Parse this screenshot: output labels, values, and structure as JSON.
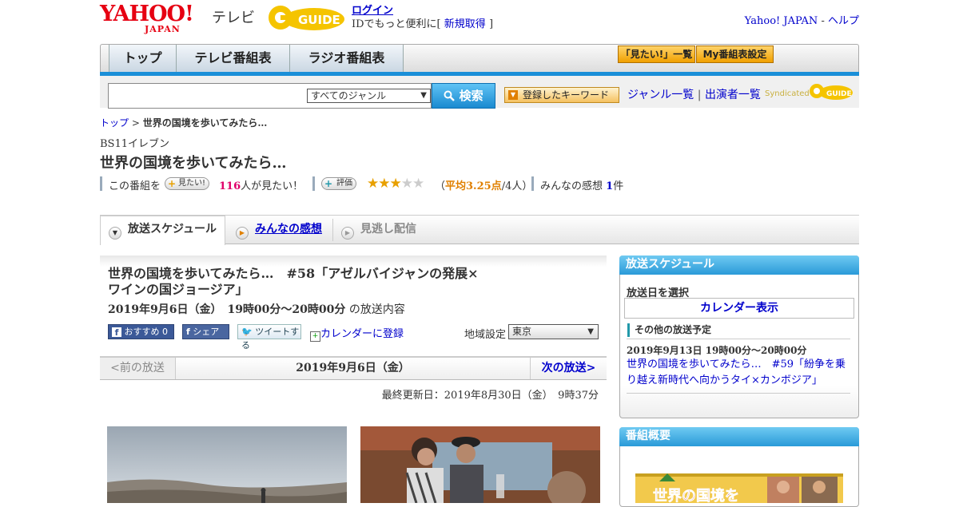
{
  "header": {
    "yahoo_logo_text": "YAHOO!",
    "yahoo_logo_sub": "JAPAN",
    "tv_label": "テレビ",
    "gguide_logo_text": "GUIDE",
    "login": "ログイン",
    "login_note_pre": "IDでもっと便利に[",
    "signup": "新規取得",
    "login_note_post": "]",
    "yahoo_japan_link": "Yahoo! JAPAN",
    "separator": "-",
    "help_link": "ヘルプ"
  },
  "nav": {
    "tabs": [
      "トップ",
      "テレビ番組表",
      "ラジオ番組表"
    ],
    "mitai_list": "「見たい!」一覧",
    "my_schedule": "My番組表設定"
  },
  "search": {
    "placeholder": "",
    "genre_selected": "すべてのジャンル",
    "search_button": "検索",
    "keyword_button": "登録したキーワード",
    "genre_list": "ジャンル一覧",
    "link_separator": "|",
    "performer_list": "出演者一覧",
    "syndicated": "Syndicated",
    "syndicated_logo_text": "GUIDE"
  },
  "breadcrumb": {
    "top": "トップ",
    "sep": ">",
    "current": "世界の国境を歩いてみたら…"
  },
  "program": {
    "channel": "BS11イレブン",
    "title": "世界の国境を歩いてみたら…",
    "want_prefix": "この番組を",
    "want_button": "見たい!",
    "want_count": "116",
    "want_suffix": "人が見たい！",
    "rating_button": "評価",
    "rating_stars": 3.25,
    "rating_text_pre": "（",
    "rating_avg": "平均3.25点",
    "rating_text_post": "/4人）",
    "impressions_label": "みんなの感想",
    "impressions_count": "1",
    "impressions_unit": "件"
  },
  "tabs": {
    "schedule": "放送スケジュール",
    "impressions": "みんなの感想",
    "missed": "見逃し配信"
  },
  "episode": {
    "title_line1": "世界の国境を歩いてみたら…　#58「アゼルバイジャンの発展×",
    "title_line2": "ワインの国ジョージア」",
    "datetime": "2019年9月6日（金）　19時00分～20時00分",
    "datetime_suffix": "の放送内容",
    "fb_recommend": "おすすめ",
    "fb_recommend_count": "0",
    "fb_share": "シェア",
    "tweet": "ツイートする",
    "calendar_register": "カレンダーに登録",
    "region_label": "地域設定",
    "region_selected": "東京",
    "prev": "<前の放送",
    "current_date": "2019年9月6日（金）",
    "next": "次の放送>",
    "updated_label": "最終更新日：2019年8月30日（金）　9時37分"
  },
  "sidebar": {
    "schedule_head": "放送スケジュール",
    "select_date": "放送日を選択",
    "calendar_button": "カレンダー表示",
    "other_head": "その他の放送予定",
    "other_date": "2019年9月13日  19時00分～20時00分",
    "other_link": "世界の国境を歩いてみたら…　#59「紛争を乗り越え新時代へ向かうタイ×カンボジア」",
    "summary_head": "番組概要",
    "banner_text": "世界の国境を"
  },
  "colors": {
    "link": "#0000cc",
    "accent_blue": "#1a8fd8",
    "pink_count": "#e0006a",
    "rating_orange": "#e08000",
    "nav_orange": "#f0a000"
  }
}
